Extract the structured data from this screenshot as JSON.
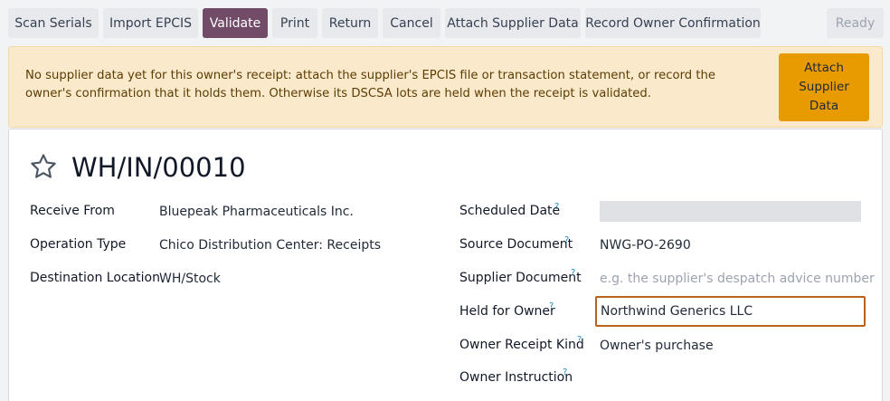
{
  "toolbar": {
    "scan_serials": "Scan Serials",
    "import_epcis": "Import EPCIS",
    "validate": "Validate",
    "print": "Print",
    "return": "Return",
    "cancel": "Cancel",
    "attach_supplier_data": "Attach Supplier Data",
    "record_owner_confirmation": "Record Owner Confirmation",
    "status": "Ready"
  },
  "alert": {
    "message": "No supplier data yet for this owner's receipt: attach the supplier's EPCIS file or transaction statement, or record the owner's confirmation that it holds them. Otherwise its DSCSA lots are held when the receipt is validated.",
    "button_label": "Attach\nSupplier\nData"
  },
  "record": {
    "title": "WH/IN/00010",
    "favorite_icon": "star-icon"
  },
  "fields": {
    "receive_from": {
      "label": "Receive From",
      "value": "Bluepeak Pharmaceuticals Inc."
    },
    "operation_type": {
      "label": "Operation Type",
      "value": "Chico Distribution Center: Receipts"
    },
    "destination_location": {
      "label": "Destination Location",
      "value": "WH/Stock"
    },
    "scheduled_date": {
      "label": "Scheduled Date",
      "help": "?",
      "value": ""
    },
    "source_document": {
      "label": "Source Document",
      "help": "?",
      "value": "NWG-PO-2690"
    },
    "supplier_document": {
      "label": "Supplier Document",
      "help": "?",
      "value": "",
      "placeholder": "e.g. the supplier's despatch advice number"
    },
    "held_for_owner": {
      "label": "Held for Owner",
      "help": "?",
      "value": "Northwind Generics LLC"
    },
    "owner_receipt_kind": {
      "label": "Owner Receipt Kind",
      "help": "?",
      "value": "Owner's purchase"
    },
    "owner_instruction": {
      "label": "Owner Instruction",
      "help": "?",
      "value": ""
    }
  },
  "colors": {
    "primary": "#714b67",
    "alert_bg": "#fbe9cb",
    "alert_button": "#e89b00",
    "focus_border": "#b8621b",
    "help": "#1f8fbf"
  }
}
